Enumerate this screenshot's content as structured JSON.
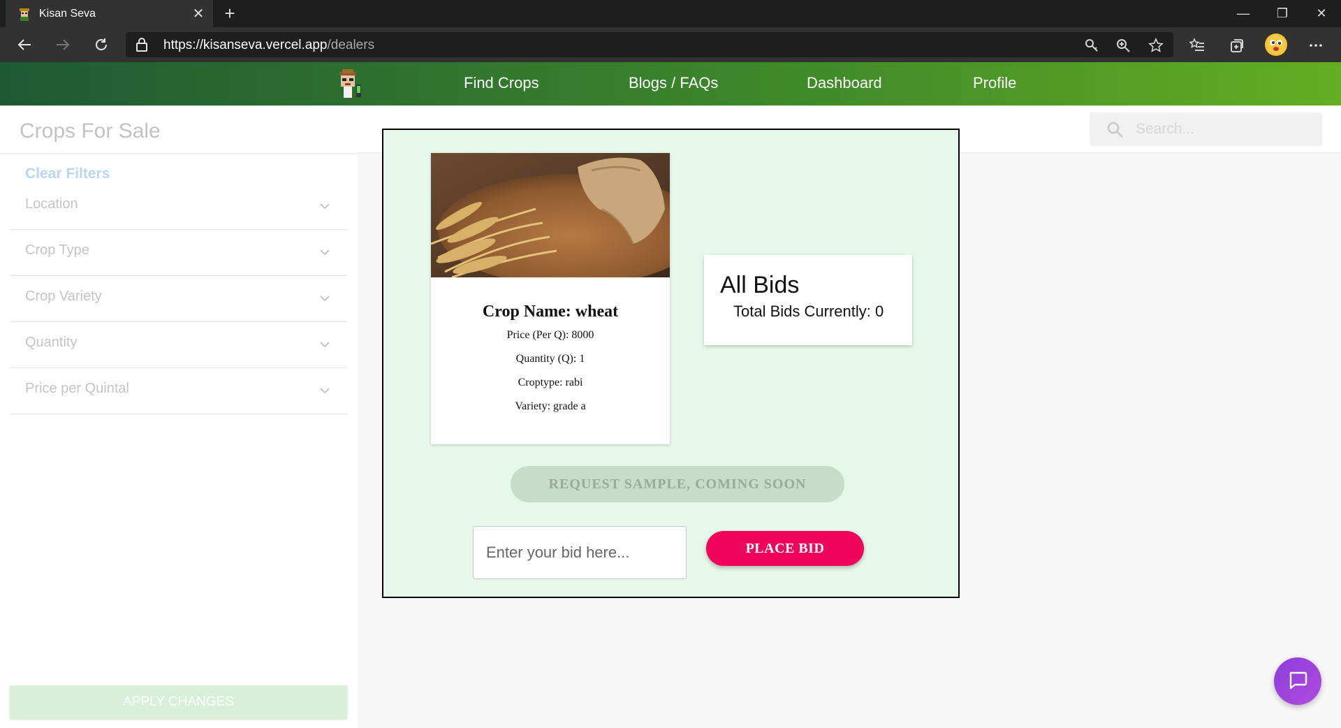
{
  "browser": {
    "tab_title": "Kisan Seva",
    "tab_close": "✕",
    "new_tab": "+",
    "url_host": "https://kisanseva.vercel.app",
    "url_path": "/dealers",
    "window_buttons": [
      "—",
      "❐",
      "✕"
    ]
  },
  "nav": {
    "links": [
      "Find Crops",
      "Blogs / FAQs",
      "Dashboard",
      "Profile"
    ]
  },
  "sidebar": {
    "title": "Crops For Sale",
    "clear_filters": "Clear Filters",
    "filters": [
      "Location",
      "Crop Type",
      "Crop Variety",
      "Quantity",
      "Price per Quintal"
    ],
    "apply_button": "APPLY CHANGES"
  },
  "search": {
    "placeholder": "Search..."
  },
  "crop": {
    "name_line": "Crop Name: wheat",
    "price_line": "Price (Per Q): 8000",
    "quantity_line": "Quantity (Q): 1",
    "croptype_line": "Croptype: rabi",
    "variety_line": "Variety: grade a"
  },
  "bids": {
    "title": "All Bids",
    "total_line": "Total Bids Currently: 0"
  },
  "actions": {
    "sample_button": "REQUEST SAMPLE, COMING SOON",
    "bid_placeholder": "Enter your bid here...",
    "place_bid": "PLACE BID"
  },
  "colors": {
    "nav_start": "#1d5a33",
    "nav_end": "#63ae22",
    "modal_bg": "#e5f8e9",
    "place_bid": "#f0055a",
    "chat_fab": "#8a3fd9"
  }
}
